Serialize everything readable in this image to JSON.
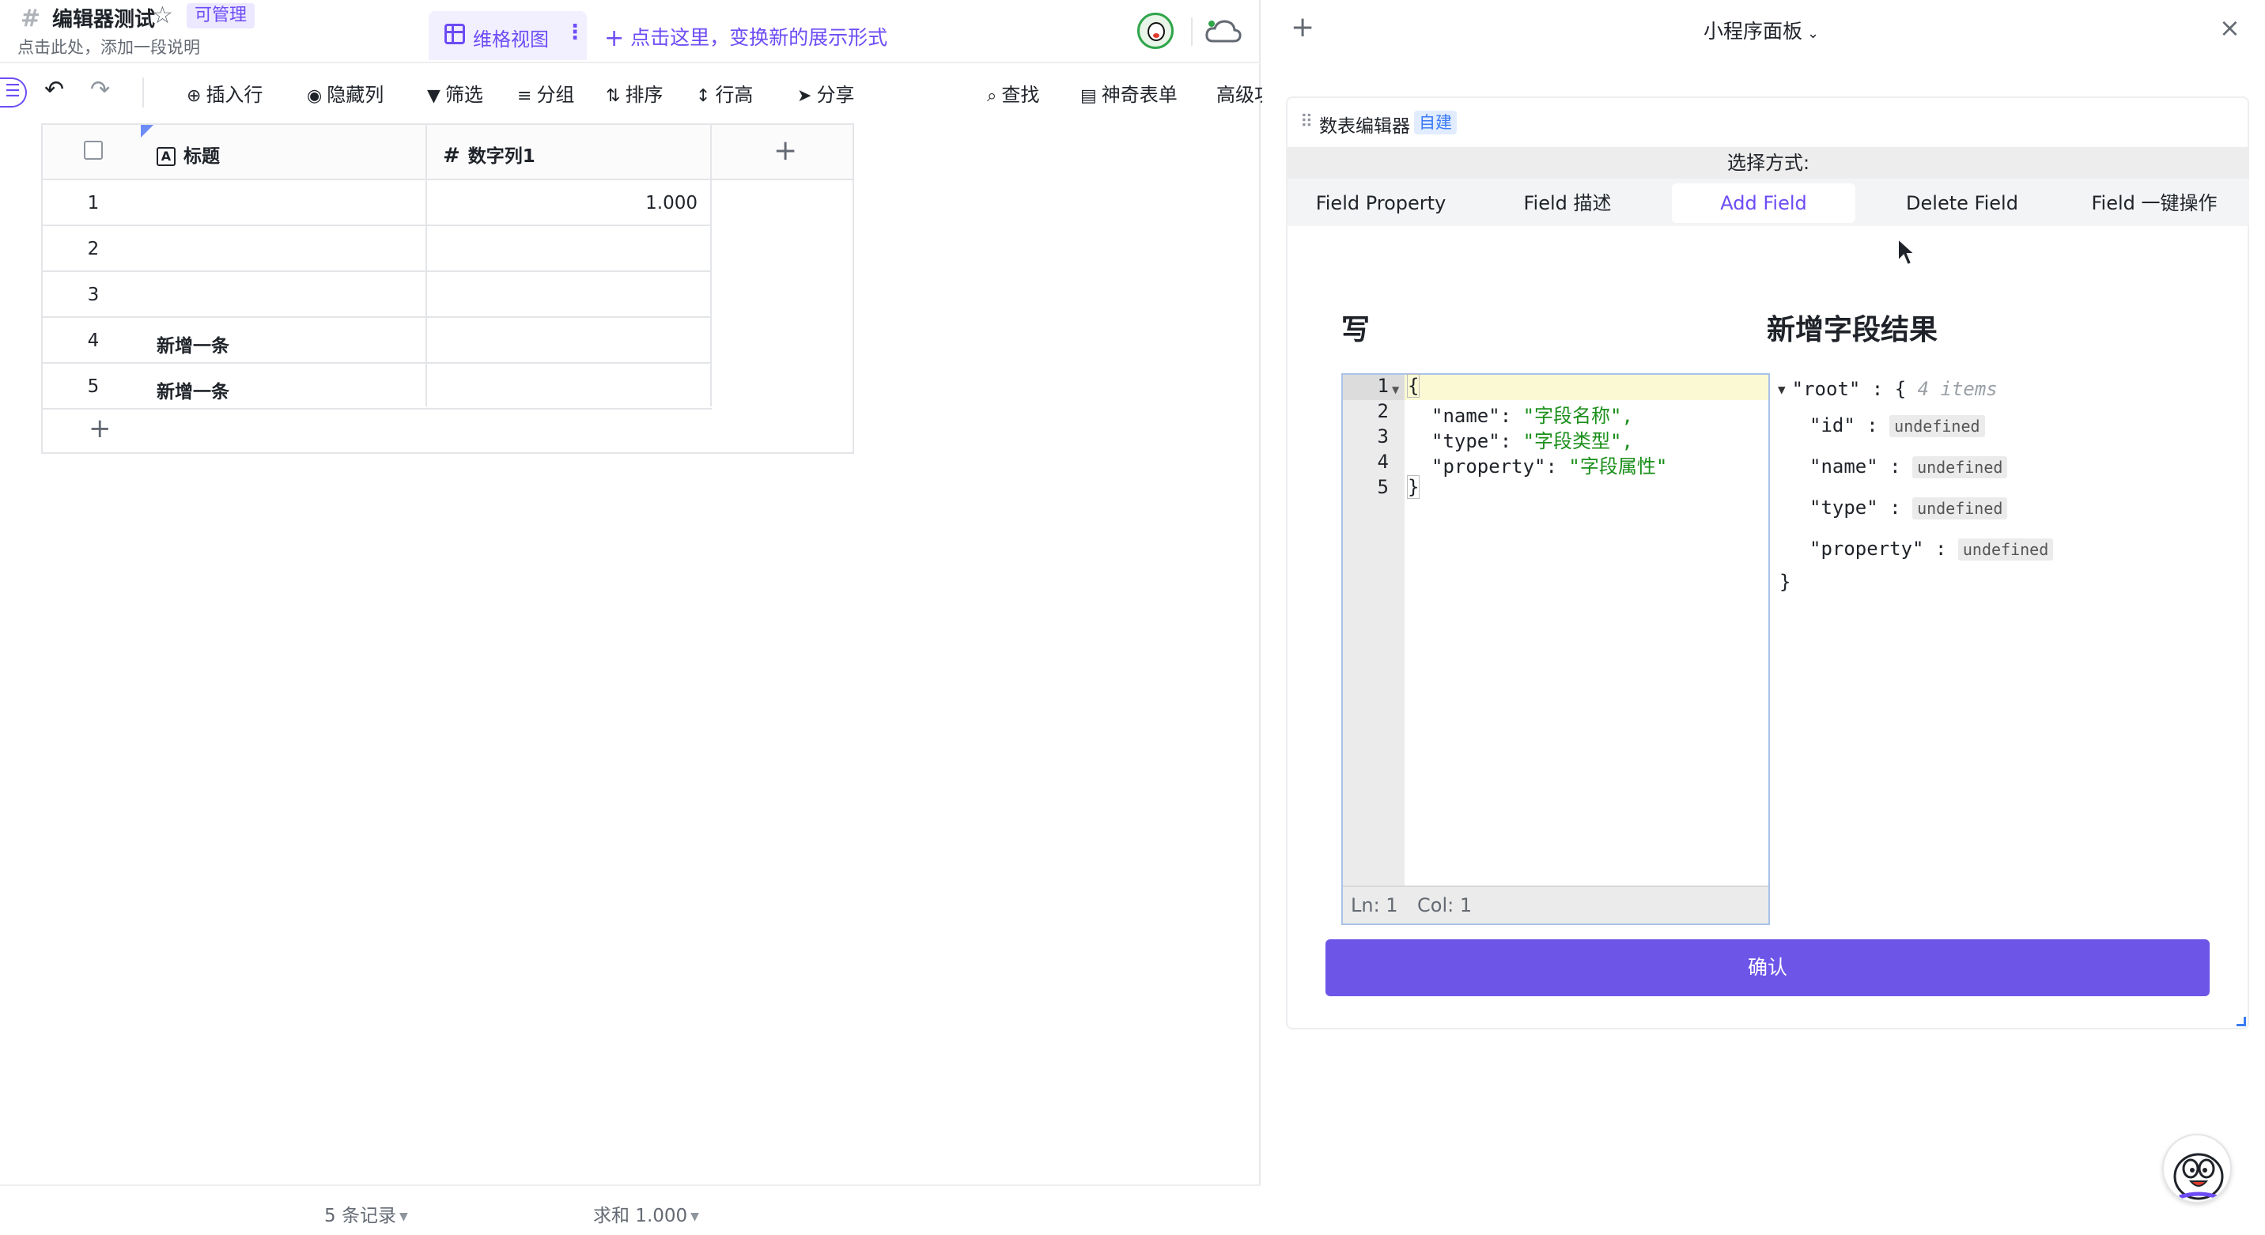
{
  "header": {
    "doc_title": "编辑器测试",
    "manage_badge": "可管理",
    "description": "点击此处，添加一段说明",
    "view_tab_label": "维格视图",
    "add_view_label": "点击这里，变换新的展示形式"
  },
  "toolbar": {
    "insert_row": "插入行",
    "hide_columns": "隐藏列",
    "filter": "筛选",
    "group": "分组",
    "sort": "排序",
    "row_height": "行高",
    "share": "分享",
    "search": "查找",
    "magic_form": "神奇表单",
    "advanced": "高级功能"
  },
  "table": {
    "columns": [
      "标题",
      "数字列1"
    ],
    "rows": [
      {
        "num": "1",
        "title": "",
        "value": "1.000"
      },
      {
        "num": "2",
        "title": "",
        "value": ""
      },
      {
        "num": "3",
        "title": "",
        "value": ""
      },
      {
        "num": "4",
        "title": "新增一条",
        "value": ""
      },
      {
        "num": "5",
        "title": "新增一条",
        "value": ""
      }
    ]
  },
  "footer": {
    "records": "5 条记录",
    "sum": "求和 1.000"
  },
  "panel": {
    "title": "小程序面板",
    "widget_name": "数表编辑器",
    "widget_badge": "自建",
    "select_label": "选择方式:",
    "tabs": [
      "Field Property",
      "Field 描述",
      "Add Field",
      "Delete Field",
      "Field 一键操作"
    ],
    "active_tab": "Add Field",
    "write_heading": "写",
    "result_heading": "新增字段结果",
    "editor": {
      "line_numbers": [
        "1",
        "2",
        "3",
        "4",
        "5"
      ],
      "lines": [
        {
          "key": "",
          "value": "{"
        },
        {
          "key": "\"name\"",
          "value": "\"字段名称\","
        },
        {
          "key": "\"type\"",
          "value": "\"字段类型\","
        },
        {
          "key": "\"property\"",
          "value": "\"字段属性\""
        },
        {
          "key": "",
          "value": "}"
        }
      ],
      "status_ln": "Ln: 1",
      "status_col": "Col: 1"
    },
    "result_tree": {
      "root_label": "\"root\"",
      "root_meta": "4 items",
      "fields": [
        {
          "key": "\"id\"",
          "value": "undefined"
        },
        {
          "key": "\"name\"",
          "value": "undefined"
        },
        {
          "key": "\"type\"",
          "value": "undefined"
        },
        {
          "key": "\"property\"",
          "value": "undefined"
        }
      ]
    },
    "confirm_label": "确认"
  },
  "colors": {
    "accent": "#6d4cf5",
    "confirm_button": "#6d55e8",
    "json_string": "#1a8f1a",
    "badge_blue": "#3b7bf6"
  }
}
